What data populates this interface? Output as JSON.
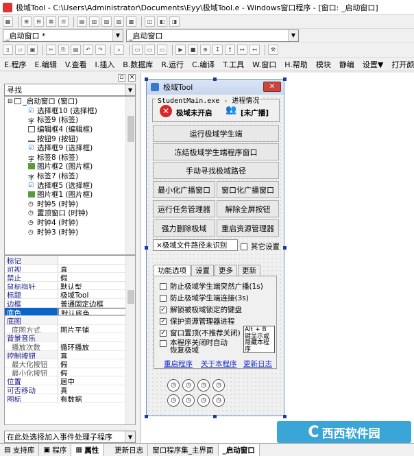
{
  "window": {
    "title": "极域Tool - C:\\Users\\Administrator\\Documents\\Eyy\\极域Tool.e - Windows窗口程序 - [窗口: _启动窗口]"
  },
  "toolbar": {
    "window_combo": "_启动窗口 *",
    "object_combo": "_启动窗口"
  },
  "menu": [
    "E.程序",
    "E.编辑",
    "V.查看",
    "I.插入",
    "B.数据库",
    "R.运行",
    "C.编译",
    "T.工具",
    "W.窗口",
    "H.帮助",
    "模块",
    "静编",
    "设置▼",
    "打开颜色拾"
  ],
  "left": {
    "search": "寻找",
    "tree": [
      "_启动窗口 (窗口)",
      "选择框10 (选择框)",
      "标签9 (标签)",
      "编辑框4 (编辑框)",
      "按钮9 (按钮)",
      "选择框9 (选择框)",
      "标签8 (标签)",
      "图片框2 (图片框)",
      "标签7 (标签)",
      "选择框5 (选择框)",
      "图片框1 (图片框)",
      "时钟5 (时钟)",
      "置顶窗口 (时钟)",
      "时钟4 (时钟)",
      "时钟3 (时钟)"
    ],
    "props": [
      {
        "n": "标记",
        "v": ""
      },
      {
        "n": "可视",
        "v": "真"
      },
      {
        "n": "禁止",
        "v": "假"
      },
      {
        "n": "鼠标指针",
        "v": "默认型"
      },
      {
        "n": "标题",
        "v": "极域Tool"
      },
      {
        "n": "边框",
        "v": "普通固定边框"
      },
      {
        "n": "底色",
        "v": "默认底色"
      },
      {
        "n": "底图",
        "v": ""
      },
      {
        "n": "底图方式",
        "v": "图片平铺"
      },
      {
        "n": "背景音乐",
        "v": ""
      },
      {
        "n": "播放次数",
        "v": "循环播放"
      },
      {
        "n": "控制按钮",
        "v": "真"
      },
      {
        "n": "最大化按钮",
        "v": "假"
      },
      {
        "n": "最小化按钮",
        "v": "假"
      },
      {
        "n": "位置",
        "v": "居中"
      },
      {
        "n": "可否移动",
        "v": "真"
      },
      {
        "n": "图标",
        "v": "有数据"
      }
    ],
    "event_combo": "在此处选择加入事件处理子程序",
    "panel_tabs": [
      "支持库",
      "程序",
      "属性"
    ]
  },
  "form": {
    "title": "极域Tool",
    "group1": "StudentMain.exe - 进程情况",
    "status1": "极域未开启",
    "status2": "[未广播]",
    "buttons": [
      "运行极域学生端",
      "冻结极域学生端程序窗口",
      "手动寻找极域路径",
      "最小化广播窗口",
      "窗口化广播窗口",
      "运行任务管理器",
      "解除全屏按钮",
      "强力删除极域",
      "重启资源管理器"
    ],
    "path_label": "×极域文件路径未识别",
    "other_settings": "其它设置",
    "tabs": [
      "功能选项",
      "设置",
      "更多",
      "更新"
    ],
    "checks": [
      {
        "label": "防止极域学生端突然广播(1s)",
        "checked": false
      },
      {
        "label": "防止极域学生端连接(3s)",
        "checked": false
      },
      {
        "label": "解锁被极域锁定的键盘",
        "checked": true
      },
      {
        "label": "保护资源管理器进程",
        "checked": true
      },
      {
        "label": "窗口置顶(不推荐关闭)",
        "checked": true
      },
      {
        "label": "本程序关闭时自动恢复极域",
        "checked": false
      }
    ],
    "hint": "Alt + B 键显示或隐藏本程序",
    "links": [
      "重启程序",
      "关于本程序",
      "更新日志"
    ]
  },
  "bottom_tabs": [
    "更新日志",
    "窗口程序集_主界面",
    "_启动窗口"
  ],
  "watermark": "西西软件园"
}
